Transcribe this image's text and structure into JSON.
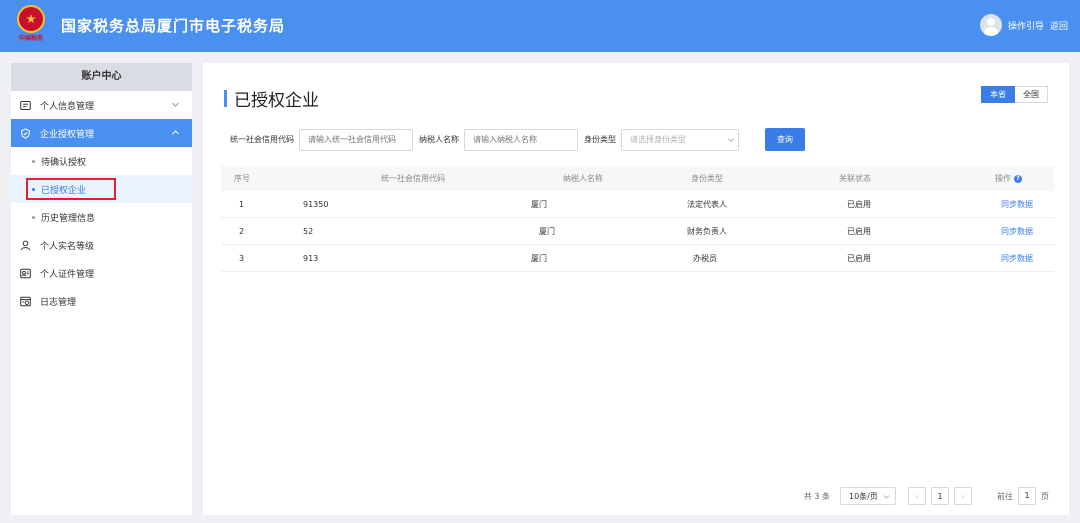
{
  "header": {
    "emblem_text": "中国税务",
    "title": "国家税务总局厦门市电子税务局",
    "guide_label": "操作引导",
    "back_label": "返回"
  },
  "sidebar": {
    "title": "账户中心",
    "items": [
      {
        "label": "个人信息管理",
        "icon": "id-card-icon"
      },
      {
        "label": "企业授权管理",
        "icon": "shield-check-icon"
      },
      {
        "label": "个人实名等级",
        "icon": "user-icon"
      },
      {
        "label": "个人证件管理",
        "icon": "certificate-icon"
      },
      {
        "label": "日志管理",
        "icon": "log-icon"
      }
    ],
    "subitems": [
      {
        "label": "待确认授权"
      },
      {
        "label": "已授权企业"
      },
      {
        "label": "历史管理信息"
      }
    ]
  },
  "main": {
    "title": "已授权企业",
    "scope": {
      "local": "本省",
      "all": "全国"
    },
    "filters": {
      "credit_code_label": "统一社会信用代码",
      "credit_code_placeholder": "请输入统一社会信用代码",
      "taxpayer_label": "纳税人名称",
      "taxpayer_placeholder": "请输入纳税人名称",
      "identity_label": "身份类型",
      "identity_placeholder": "请选择身份类型",
      "query_label": "查询"
    },
    "table": {
      "headers": [
        "序号",
        "统一社会信用代码",
        "纳税人名称",
        "身份类型",
        "关联状态",
        "操作"
      ],
      "rows": [
        {
          "index": "1",
          "code": "91350",
          "name": "厦门",
          "identity": "法定代表人",
          "status": "已启用",
          "action": "同步数据"
        },
        {
          "index": "2",
          "code": "52",
          "name": "厦门",
          "identity": "财务负责人",
          "status": "已启用",
          "action": "同步数据"
        },
        {
          "index": "3",
          "code": "913",
          "name": "厦门",
          "identity": "办税员",
          "status": "已启用",
          "action": "同步数据"
        }
      ]
    },
    "pager": {
      "total": "共 3 条",
      "page_size": "10条/页",
      "prev": "‹",
      "current": "1",
      "next": "›",
      "goto_label": "前往",
      "goto_value": "1",
      "page_unit": "页"
    }
  },
  "colors": {
    "brand": "#4a90f0",
    "accent": "#3a7de8",
    "highlight": "#e0202b"
  }
}
